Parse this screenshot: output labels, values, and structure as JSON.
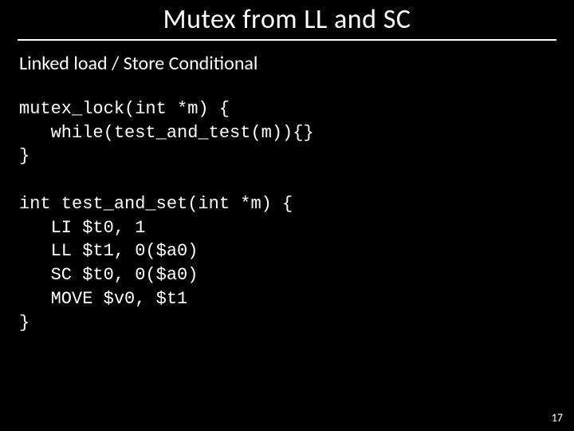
{
  "title": "Mutex from LL and SC",
  "subheading": "Linked load / Store Conditional",
  "code_block_1": "mutex_lock(int *m) {\n   while(test_and_test(m)){}\n}",
  "code_block_2": "int test_and_set(int *m) {\n   LI $t0, 1\n   LL $t1, 0($a0)\n   SC $t0, 0($a0)\n   MOVE $v0, $t1\n}",
  "page_number": "17"
}
